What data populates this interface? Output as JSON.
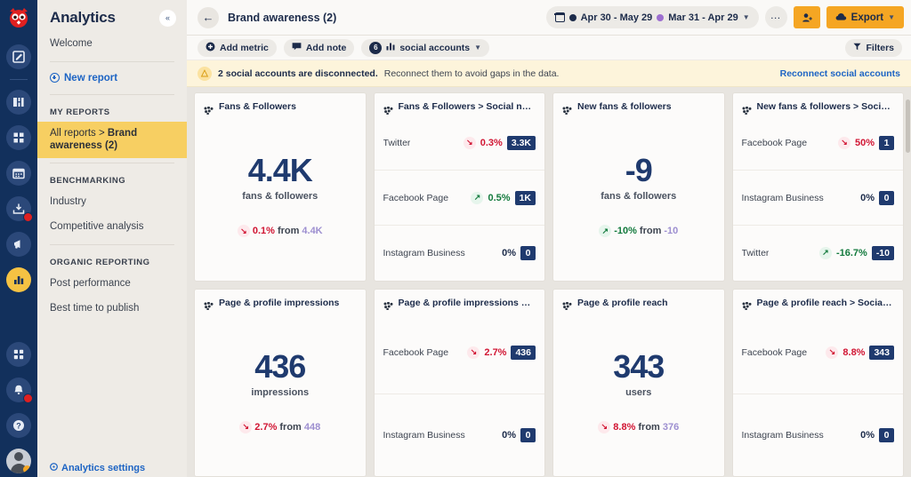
{
  "rail": {
    "logo": "hootsuite-owl-logo",
    "items": [
      {
        "name": "compose-icon",
        "glyph": "✎"
      },
      {
        "name": "streams-icon",
        "glyph": "◧"
      },
      {
        "name": "planner-grid-icon",
        "glyph": "☷"
      },
      {
        "name": "calendar-icon",
        "glyph": "Ὄ5"
      },
      {
        "name": "inbox-icon",
        "glyph": "⤓",
        "badge": true
      },
      {
        "name": "amplify-megaphone-icon",
        "glyph": "◀"
      },
      {
        "name": "analytics-icon",
        "glyph": "▐",
        "active": true
      },
      {
        "name": "apps-grid-icon",
        "glyph": "☷"
      },
      {
        "name": "notifications-bell-icon",
        "glyph": "ὑ4",
        "badge": true
      },
      {
        "name": "help-icon",
        "glyph": "?"
      }
    ]
  },
  "sidebar": {
    "title": "Analytics",
    "collapse_glyph": "«",
    "welcome": "Welcome",
    "new_report": "New report",
    "section_my_reports": "MY REPORTS",
    "active_report_prefix": "All reports > ",
    "active_report_name": "Brand awareness (2)",
    "section_benchmarking": "BENCHMARKING",
    "benchmarking_items": [
      "Industry",
      "Competitive analysis"
    ],
    "section_organic": "ORGANIC REPORTING",
    "organic_items": [
      "Post performance",
      "Best time to publish"
    ],
    "settings_link": "Analytics settings"
  },
  "header": {
    "back_glyph": "←",
    "title": "Brand awareness (2)",
    "date_primary": "Apr 30 - May 29",
    "date_compare": "Mar 31 - Apr 29",
    "more_glyph": "…",
    "share_label": "",
    "export_label": "Export",
    "accent_orange": "#f5a623"
  },
  "toolbar": {
    "add_metric": "Add metric",
    "add_note": "Add note",
    "social_accounts_count": "6",
    "social_accounts_label": "social accounts",
    "filters_label": "Filters"
  },
  "banner": {
    "icon": "warning-icon",
    "bold_text": "2 social accounts are disconnected.",
    "text": " Reconnect them to avoid gaps in the data.",
    "link": "Reconnect social accounts"
  },
  "cards": [
    {
      "type": "big",
      "title": "Fans & Followers",
      "value": "4.4K",
      "label": "fans & followers",
      "direction": "down",
      "pct": "0.1%",
      "from_word": "from",
      "prev": "4.4K"
    },
    {
      "type": "rows",
      "title": "Fans & Followers > Social net…",
      "rows": [
        {
          "name": "Twitter",
          "direction": "down",
          "pct": "0.3%",
          "value": "3.3K"
        },
        {
          "name": "Facebook Page",
          "direction": "up",
          "pct": "0.5%",
          "value": "1K"
        },
        {
          "name": "Instagram Business",
          "direction": "flat",
          "pct": "0%",
          "value": "0"
        }
      ]
    },
    {
      "type": "big",
      "title": "New fans & followers",
      "value": "-9",
      "label": "fans & followers",
      "direction": "up",
      "pct": "-10%",
      "from_word": "from",
      "prev": "-10"
    },
    {
      "type": "rows",
      "title": "New fans & followers > Social …",
      "rows": [
        {
          "name": "Facebook Page",
          "direction": "down",
          "pct": "50%",
          "value": "1"
        },
        {
          "name": "Instagram Business",
          "direction": "flat",
          "pct": "0%",
          "value": "0"
        },
        {
          "name": "Twitter",
          "direction": "up",
          "pct": "-16.7%",
          "value": "-10"
        }
      ]
    },
    {
      "type": "big",
      "title": "Page & profile impressions",
      "value": "436",
      "label": "impressions",
      "direction": "down",
      "pct": "2.7%",
      "from_word": "from",
      "prev": "448"
    },
    {
      "type": "rows",
      "title": "Page & profile impressions > S…",
      "rows": [
        {
          "name": "Facebook Page",
          "direction": "down",
          "pct": "2.7%",
          "value": "436"
        },
        {
          "name": "Instagram Business",
          "direction": "flat",
          "pct": "0%",
          "value": "0"
        }
      ]
    },
    {
      "type": "big",
      "title": "Page & profile reach",
      "value": "343",
      "label": "users",
      "direction": "down",
      "pct": "8.8%",
      "from_word": "from",
      "prev": "376"
    },
    {
      "type": "rows",
      "title": "Page & profile reach > Social n…",
      "rows": [
        {
          "name": "Facebook Page",
          "direction": "down",
          "pct": "8.8%",
          "value": "343"
        },
        {
          "name": "Instagram Business",
          "direction": "flat",
          "pct": "0%",
          "value": "0"
        }
      ]
    }
  ]
}
